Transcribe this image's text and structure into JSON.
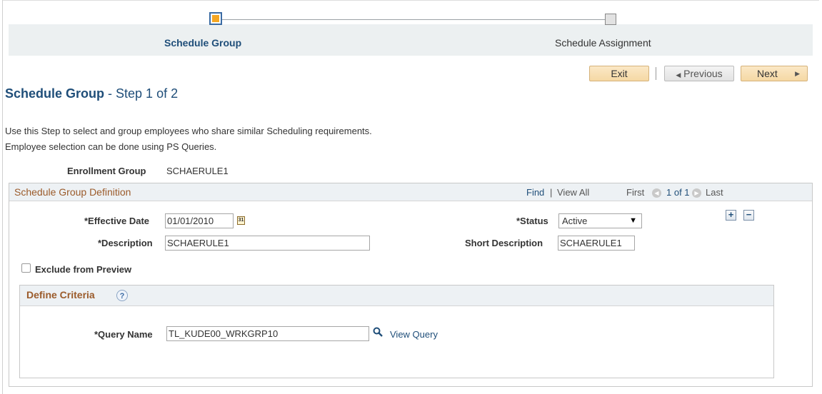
{
  "train": {
    "steps": [
      {
        "label": "Schedule Group",
        "active": true
      },
      {
        "label": "Schedule Assignment",
        "active": false
      }
    ]
  },
  "toolbar": {
    "exit_label": "Exit",
    "previous_label": "Previous",
    "next_label": "Next"
  },
  "page": {
    "title": "Schedule Group",
    "step_text": " - Step 1 of 2",
    "instructions": [
      "Use this Step to select and group employees who share similar Scheduling requirements.",
      "Employee selection can be done using PS Queries."
    ],
    "enrollment_group_label": "Enrollment Group",
    "enrollment_group_value": "SCHAERULE1"
  },
  "definition": {
    "title": "Schedule Group Definition",
    "find_label": "Find",
    "view_all_label": "View All",
    "first_label": "First",
    "count_label": "1 of 1",
    "last_label": "Last",
    "effective_date_label": "*Effective Date",
    "effective_date_value": "01/01/2010",
    "status_label": "*Status",
    "status_value": "Active",
    "description_label": "*Description",
    "description_value": "SCHAERULE1",
    "short_description_label": "Short Description",
    "short_description_value": "SCHAERULE1",
    "exclude_label": "Exclude from Preview"
  },
  "criteria": {
    "title": "Define Criteria",
    "query_name_label": "*Query Name",
    "query_name_value": "TL_KUDE00_WRKGRP10",
    "view_query_label": "View Query"
  },
  "colors": {
    "accent": "#1f4e79",
    "section_title": "#9b5b2b",
    "button_bg": "#f5d8a4",
    "active_stop": "#f5a623"
  }
}
